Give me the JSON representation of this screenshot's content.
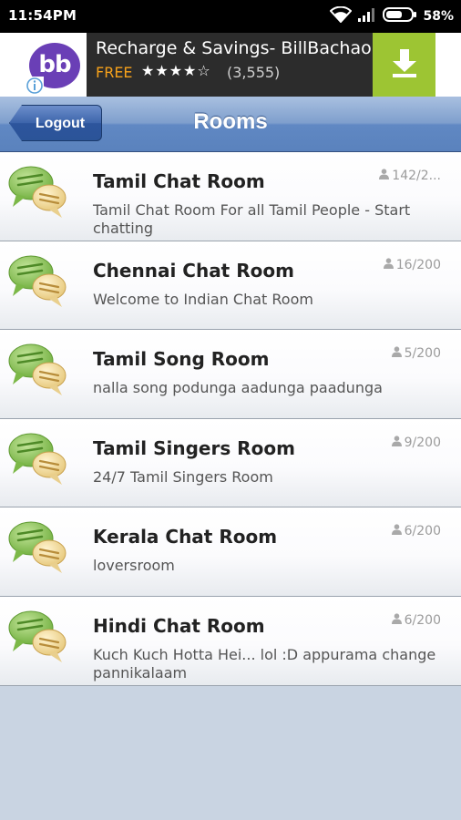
{
  "status": {
    "time": "11:54PM",
    "battery": "58%",
    "icons": [
      "wifi-icon",
      "signal-icon",
      "battery-icon"
    ]
  },
  "ad": {
    "logo_text": "bb",
    "title": "Recharge & Savings- BillBachao",
    "price": "FREE",
    "stars": "★★★★☆",
    "rating_count": "(3,555)",
    "download_icon": "download-icon",
    "info_icon": "info-icon",
    "colors": {
      "download": "#9dc533",
      "logo": "#6a3fb6",
      "price": "#f7a21b"
    }
  },
  "header": {
    "back_label": "Logout",
    "title": "Rooms"
  },
  "rooms": [
    {
      "name": "Tamil Chat Room",
      "description": "Tamil Chat Room For all Tamil People - Start chatting",
      "count": "142/2..."
    },
    {
      "name": "Chennai Chat Room",
      "description": "Welcome to Indian Chat Room",
      "count": "16/200"
    },
    {
      "name": "Tamil Song Room",
      "description": "nalla song podunga aadunga paadunga",
      "count": "5/200"
    },
    {
      "name": "Tamil Singers Room",
      "description": "24/7 Tamil Singers Room",
      "count": "9/200"
    },
    {
      "name": "Kerala Chat Room",
      "description": "loversroom",
      "count": "6/200"
    },
    {
      "name": "Hindi Chat Room",
      "description": "Kuch Kuch Hotta Hei... lol :D appurama change pannikalaam",
      "count": "6/200"
    }
  ]
}
